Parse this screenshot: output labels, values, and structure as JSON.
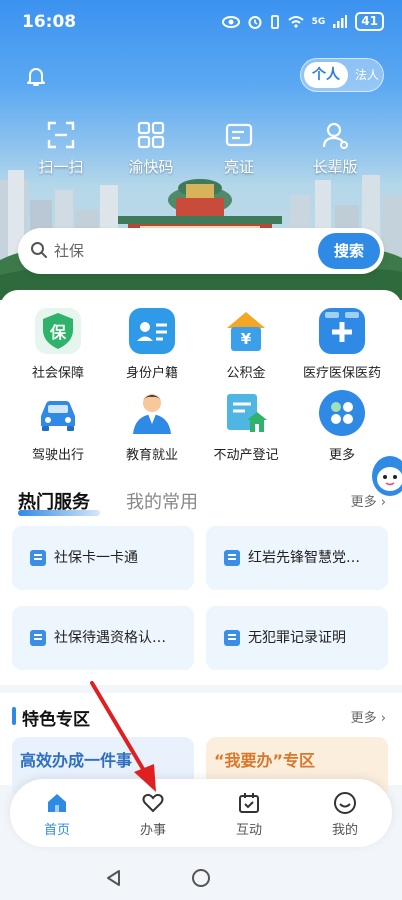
{
  "status": {
    "time": "16:08",
    "network": "5G",
    "battery": "41"
  },
  "header": {
    "toggle_active": "个人",
    "toggle_inactive": "法人",
    "quick_actions": [
      {
        "label": "扫一扫",
        "icon": "scan-icon"
      },
      {
        "label": "渝快码",
        "icon": "qr-code-icon"
      },
      {
        "label": "亮证",
        "icon": "id-card-icon"
      },
      {
        "label": "长辈版",
        "icon": "elder-mode-icon"
      }
    ]
  },
  "search": {
    "placeholder": "社保",
    "button_label": "搜索"
  },
  "services": [
    {
      "label": "社会保障",
      "icon": "social-security-icon"
    },
    {
      "label": "身份户籍",
      "icon": "identity-icon"
    },
    {
      "label": "公积金",
      "icon": "housing-fund-icon"
    },
    {
      "label": "医疗医保医药",
      "icon": "medical-icon"
    },
    {
      "label": "驾驶出行",
      "icon": "car-icon"
    },
    {
      "label": "教育就业",
      "icon": "education-icon"
    },
    {
      "label": "不动产登记",
      "icon": "real-estate-icon"
    },
    {
      "label": "更多",
      "icon": "more-icon"
    }
  ],
  "hot_services": {
    "tab_hot": "热门服务",
    "tab_common": "我的常用",
    "more_label": "更多",
    "items": [
      "社保卡一卡通",
      "红岩先锋智慧党…",
      "社保待遇资格认…",
      "无犯罪记录证明"
    ]
  },
  "feature": {
    "title": "特色专区",
    "more_label": "更多",
    "card_a": "高效办成一件事",
    "card_b": "“我要办”专区"
  },
  "nav": [
    {
      "label": "首页",
      "icon": "home-icon",
      "active": true
    },
    {
      "label": "办事",
      "icon": "heart-icon",
      "active": false
    },
    {
      "label": "互动",
      "icon": "calendar-check-icon",
      "active": false
    },
    {
      "label": "我的",
      "icon": "smile-icon",
      "active": false
    }
  ],
  "colors": {
    "accent": "#2f8ae6",
    "annotation_arrow": "#e02020"
  }
}
